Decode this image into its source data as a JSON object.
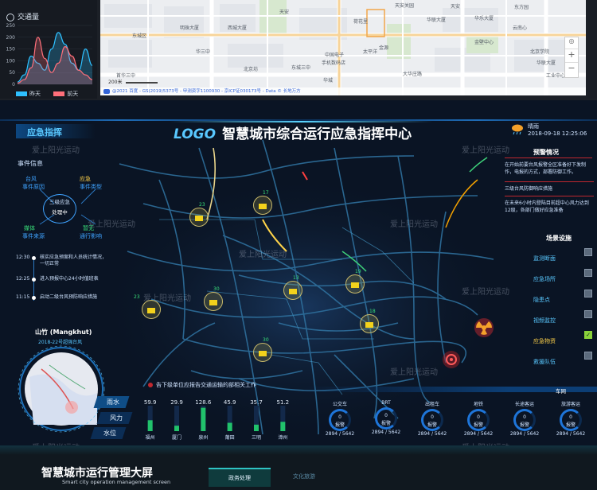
{
  "traffic_chart": {
    "title": "交通量",
    "legend": [
      {
        "label": "昨天",
        "color": "#2ec0ff"
      },
      {
        "label": "前天",
        "color": "#ff6f7a"
      }
    ],
    "chart_data": {
      "type": "area",
      "title": "交通量",
      "y_ticks": [
        "250",
        "200",
        "150",
        "100",
        "50",
        "0"
      ],
      "ylim": [
        0,
        250
      ],
      "x": [
        0,
        1,
        2,
        3,
        4,
        5,
        6,
        7,
        8,
        9,
        10,
        11
      ],
      "series": [
        {
          "name": "昨天",
          "color": "#2ec0ff",
          "values": [
            10,
            40,
            120,
            90,
            60,
            150,
            220,
            170,
            90,
            60,
            150,
            80
          ]
        },
        {
          "name": "前天",
          "color": "#ff6f7a",
          "values": [
            5,
            20,
            70,
            200,
            110,
            50,
            90,
            160,
            120,
            60,
            40,
            20
          ]
        }
      ]
    }
  },
  "map_top": {
    "labels": [
      "天安关园",
      "荷花里",
      "天安",
      "华乐大厦",
      "天安",
      "东方园",
      "金壁中心",
      "云南心",
      "中国电子",
      "手机数码店",
      "首华三中",
      "北京坊",
      "华三中",
      "太平洋",
      "金源",
      "东城三中",
      "大华庄路",
      "华联大厦",
      "北京学院",
      "华联大厦",
      "东城区",
      "明珠大厦",
      "西城大厦",
      "华城",
      "工业中心"
    ],
    "copyright": "@2021 百度 - GS(2019)5373号 - 甲测资字1100930 - 京ICP证030173号 - Data © 长地万方",
    "scale": "200米",
    "zoom_in": "+",
    "zoom_out": "−"
  },
  "header": {
    "logo": "LOGO",
    "title": "智慧城市综合运行应急指挥中心",
    "weather": "晴雨",
    "datetime": "2018-09-18 12:25:06"
  },
  "left_panel": {
    "section_title": "应急指挥",
    "event_info_title": "事件信息",
    "event_nodes": [
      {
        "top": "台风",
        "bottom": "事件原因",
        "color": "blue"
      },
      {
        "top": "应急",
        "bottom": "事件类型",
        "color": "yellow"
      },
      {
        "top": "媒体",
        "bottom": "事件来源",
        "color": "green"
      },
      {
        "top": "暂无",
        "bottom": "通行影响",
        "color": "blue"
      }
    ],
    "center_node": {
      "line1": "三级应急",
      "line2": "处理中"
    },
    "timeline": [
      {
        "time": "12:30",
        "text": "核实应急预案和人员统计情况，一切正常"
      },
      {
        "time": "12:25",
        "text": "进入预报中心24小时值班表"
      },
      {
        "time": "11:15",
        "text": "启动二级台风预防响应措施"
      }
    ],
    "typhoon_name": "山竹 (Mangkhut)",
    "typhoon_sub": "2018-22号超强台风",
    "typhoon_tabs": [
      "雨水",
      "风力",
      "水位"
    ]
  },
  "right_panel": {
    "warning_title": "预警情况",
    "warnings": [
      "在开始前要台风报警全区准备好下发制作，电报的方式，部署防御工作。",
      "三级台风防御响应措施",
      "在未来6小时内登陆目前超中心风力达到12级，各部门做好应急准备"
    ],
    "facility_title": "场景设施",
    "facilities": [
      {
        "label": "监测断面",
        "checked": false
      },
      {
        "label": "应急场所",
        "checked": false
      },
      {
        "label": "隐患点",
        "checked": false
      },
      {
        "label": "视频监控",
        "checked": false
      },
      {
        "label": "应急物资",
        "checked": true
      },
      {
        "label": "救援队伍",
        "checked": false
      }
    ]
  },
  "map_markers": [
    {
      "count": "23"
    },
    {
      "count": "17"
    },
    {
      "count": "13"
    },
    {
      "count": "19"
    },
    {
      "count": "30"
    },
    {
      "count": "18"
    },
    {
      "count": "30"
    },
    {
      "count": "23"
    }
  ],
  "notice": "告下级单位应报告交通运输的部相关工作",
  "rain_chart": {
    "chart_data": {
      "type": "bar",
      "categories": [
        "福州",
        "厦门",
        "泉州",
        "莆田",
        "三明",
        "漳州"
      ],
      "values": [
        59.9,
        29.9,
        128.6,
        45.9,
        35.7,
        51.2
      ],
      "ylim": [
        0,
        140
      ],
      "value_labels": [
        "59.9",
        "29.9",
        "128.6",
        "45.9",
        "35.7",
        "51.2"
      ]
    }
  },
  "vehicles": {
    "title": "车网",
    "items": [
      {
        "label": "公交车",
        "count": "0",
        "status": "报警",
        "ratio": "2894 / 5642"
      },
      {
        "label": "BRT",
        "count": "0",
        "status": "报警",
        "ratio": "2894 / 5642"
      },
      {
        "label": "出租车",
        "count": "0",
        "status": "报警",
        "ratio": "2894 / 5642"
      },
      {
        "label": "地铁",
        "count": "0",
        "status": "报警",
        "ratio": "2894 / 5642"
      },
      {
        "label": "长途客运",
        "count": "0",
        "status": "报警",
        "ratio": "2894 / 5642"
      },
      {
        "label": "旅游客运",
        "count": "0",
        "status": "报警",
        "ratio": "2894 / 5642"
      }
    ]
  },
  "bottom": {
    "title": "智慧城市运行管理大屏",
    "subtitle": "Smart city operation management screen",
    "tabs": [
      {
        "label": "政务处理",
        "active": true
      },
      {
        "label": "文化旅游",
        "active": false
      }
    ]
  },
  "watermark": "爱上阳光运动"
}
